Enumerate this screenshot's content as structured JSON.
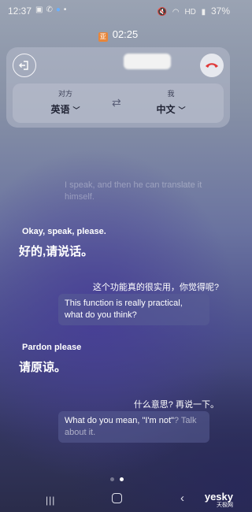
{
  "status_bar": {
    "time": "12:37",
    "notifications": [
      "gallery-icon",
      "phone-icon",
      "bixby-icon",
      "dot-icon"
    ],
    "right_icons": [
      "mute-icon",
      "wifi-icon",
      "hd-icon",
      "signal-icon"
    ],
    "hd_label": "HD",
    "battery": "37%"
  },
  "call": {
    "timer": "02:25",
    "timer_icon_glyph": "亚"
  },
  "languages": {
    "other_role": "对方",
    "other_lang": "英语",
    "my_role": "我",
    "my_lang": "中文"
  },
  "transcript": {
    "faded_message": "I speak, and then he can translate it himself.",
    "messages": [
      {
        "speaker": "other",
        "original": "Okay, speak, please.",
        "translation": "好的,请说话。"
      },
      {
        "speaker": "me",
        "original": "这个功能真的很实用，你觉得呢?",
        "translation": "This function is really practical, what do you think?"
      },
      {
        "speaker": "other",
        "original": "Pardon please",
        "translation": "请原谅。"
      },
      {
        "speaker": "me",
        "original": "什么意思? 再说一下。",
        "translation_main": "What do you mean, \"I'm not\"",
        "translation_faded": "? Talk about it."
      }
    ]
  },
  "pager": {
    "count": 2,
    "active": 2
  },
  "watermark": {
    "main": "yesky",
    "sub": "天极网"
  },
  "colors": {
    "end_call": "#e03a3a",
    "accent_bubble": "#5a5f96"
  }
}
